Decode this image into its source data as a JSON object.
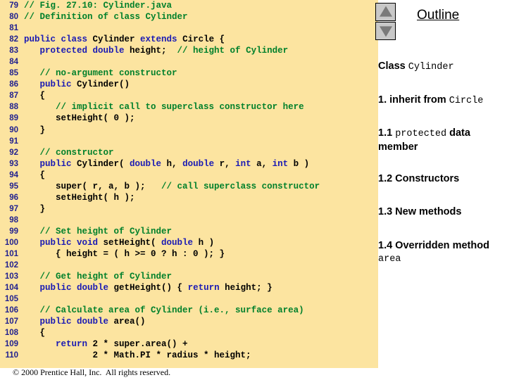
{
  "slide": {
    "background_color": "#ffffff",
    "code_panel_color": "#fce4a0"
  },
  "footer": {
    "text": "© 2000 Prentice Hall, Inc.  All rights reserved."
  },
  "outline": {
    "title": "Outline",
    "scroll_up_icon": "triangle-up-icon",
    "scroll_down_icon": "triangle-down-icon",
    "items": [
      {
        "prefix": "Class ",
        "mono": "Cylinder",
        "suffix": ""
      },
      {
        "prefix": "1. inherit from ",
        "mono": "Circle",
        "suffix": ""
      },
      {
        "prefix": "1.1 ",
        "mono": "protected",
        "suffix": " data member"
      },
      {
        "prefix": "1.2 Constructors",
        "mono": "",
        "suffix": ""
      },
      {
        "prefix": "1.3 New methods",
        "mono": "",
        "suffix": ""
      },
      {
        "prefix": "1.4 Overridden method ",
        "mono": "area",
        "suffix": ""
      }
    ]
  },
  "code": {
    "language": "java",
    "colors": {
      "line_number": "#1f1f8f",
      "keyword": "#1a1ab4",
      "identifier": "#000000",
      "comment": "#00802b"
    },
    "lines": [
      {
        "n": "79",
        "tokens": [
          {
            "t": "// Fig. 27.10: Cylinder.java",
            "c": "cm"
          }
        ]
      },
      {
        "n": "80",
        "tokens": [
          {
            "t": "// Definition of class Cylinder",
            "c": "cm"
          }
        ]
      },
      {
        "n": "81",
        "tokens": [
          {
            "t": "",
            "c": "id"
          }
        ]
      },
      {
        "n": "82",
        "tokens": [
          {
            "t": "public class ",
            "c": "k"
          },
          {
            "t": "Cylinder ",
            "c": "id"
          },
          {
            "t": "extends ",
            "c": "k"
          },
          {
            "t": "Circle {",
            "c": "id"
          }
        ]
      },
      {
        "n": "83",
        "tokens": [
          {
            "t": "   protected double ",
            "c": "k"
          },
          {
            "t": "height;  ",
            "c": "id"
          },
          {
            "t": "// height of Cylinder",
            "c": "cm"
          }
        ]
      },
      {
        "n": "84",
        "tokens": [
          {
            "t": "",
            "c": "id"
          }
        ]
      },
      {
        "n": "85",
        "tokens": [
          {
            "t": "   ",
            "c": "id"
          },
          {
            "t": "// no-argument constructor",
            "c": "cm"
          }
        ]
      },
      {
        "n": "86",
        "tokens": [
          {
            "t": "   public ",
            "c": "k"
          },
          {
            "t": "Cylinder()",
            "c": "id"
          }
        ]
      },
      {
        "n": "87",
        "tokens": [
          {
            "t": "   {",
            "c": "id"
          }
        ]
      },
      {
        "n": "88",
        "tokens": [
          {
            "t": "      ",
            "c": "id"
          },
          {
            "t": "// implicit call to superclass constructor here",
            "c": "cm"
          }
        ]
      },
      {
        "n": "89",
        "tokens": [
          {
            "t": "      setHeight( 0 );",
            "c": "id"
          }
        ]
      },
      {
        "n": "90",
        "tokens": [
          {
            "t": "   }",
            "c": "id"
          }
        ]
      },
      {
        "n": "91",
        "tokens": [
          {
            "t": "",
            "c": "id"
          }
        ]
      },
      {
        "n": "92",
        "tokens": [
          {
            "t": "   ",
            "c": "id"
          },
          {
            "t": "// constructor",
            "c": "cm"
          }
        ]
      },
      {
        "n": "93",
        "tokens": [
          {
            "t": "   public ",
            "c": "k"
          },
          {
            "t": "Cylinder( ",
            "c": "id"
          },
          {
            "t": "double ",
            "c": "k"
          },
          {
            "t": "h, ",
            "c": "id"
          },
          {
            "t": "double ",
            "c": "k"
          },
          {
            "t": "r, ",
            "c": "id"
          },
          {
            "t": "int ",
            "c": "k"
          },
          {
            "t": "a, ",
            "c": "id"
          },
          {
            "t": "int ",
            "c": "k"
          },
          {
            "t": "b )",
            "c": "id"
          }
        ]
      },
      {
        "n": "94",
        "tokens": [
          {
            "t": "   {",
            "c": "id"
          }
        ]
      },
      {
        "n": "95",
        "tokens": [
          {
            "t": "      super( r, a, b );   ",
            "c": "id"
          },
          {
            "t": "// call superclass constructor",
            "c": "cm"
          }
        ]
      },
      {
        "n": "96",
        "tokens": [
          {
            "t": "      setHeight( h );",
            "c": "id"
          }
        ]
      },
      {
        "n": "97",
        "tokens": [
          {
            "t": "   }",
            "c": "id"
          }
        ]
      },
      {
        "n": "98",
        "tokens": [
          {
            "t": "",
            "c": "id"
          }
        ]
      },
      {
        "n": "99",
        "tokens": [
          {
            "t": "   ",
            "c": "id"
          },
          {
            "t": "// Set height of Cylinder",
            "c": "cm"
          }
        ]
      },
      {
        "n": "100",
        "tokens": [
          {
            "t": "   public void ",
            "c": "k"
          },
          {
            "t": "setHeight( ",
            "c": "id"
          },
          {
            "t": "double ",
            "c": "k"
          },
          {
            "t": "h )",
            "c": "id"
          }
        ]
      },
      {
        "n": "101",
        "tokens": [
          {
            "t": "      { height = ( h >= 0 ? h : 0 ); }",
            "c": "id"
          }
        ]
      },
      {
        "n": "102",
        "tokens": [
          {
            "t": "",
            "c": "id"
          }
        ]
      },
      {
        "n": "103",
        "tokens": [
          {
            "t": "   ",
            "c": "id"
          },
          {
            "t": "// Get height of Cylinder",
            "c": "cm"
          }
        ]
      },
      {
        "n": "104",
        "tokens": [
          {
            "t": "   public double ",
            "c": "k"
          },
          {
            "t": "getHeight() { ",
            "c": "id"
          },
          {
            "t": "return ",
            "c": "k"
          },
          {
            "t": "height; }",
            "c": "id"
          }
        ]
      },
      {
        "n": "105",
        "tokens": [
          {
            "t": "",
            "c": "id"
          }
        ]
      },
      {
        "n": "106",
        "tokens": [
          {
            "t": "   ",
            "c": "id"
          },
          {
            "t": "// Calculate area of Cylinder (i.e., surface area)",
            "c": "cm"
          }
        ]
      },
      {
        "n": "107",
        "tokens": [
          {
            "t": "   public double ",
            "c": "k"
          },
          {
            "t": "area()",
            "c": "id"
          }
        ]
      },
      {
        "n": "108",
        "tokens": [
          {
            "t": "   {",
            "c": "id"
          }
        ]
      },
      {
        "n": "109",
        "tokens": [
          {
            "t": "      ",
            "c": "id"
          },
          {
            "t": "return ",
            "c": "k"
          },
          {
            "t": "2 * super.area() +",
            "c": "id"
          }
        ]
      },
      {
        "n": "110",
        "tokens": [
          {
            "t": "             2 * Math.PI * radius * height;",
            "c": "id"
          }
        ]
      }
    ]
  }
}
